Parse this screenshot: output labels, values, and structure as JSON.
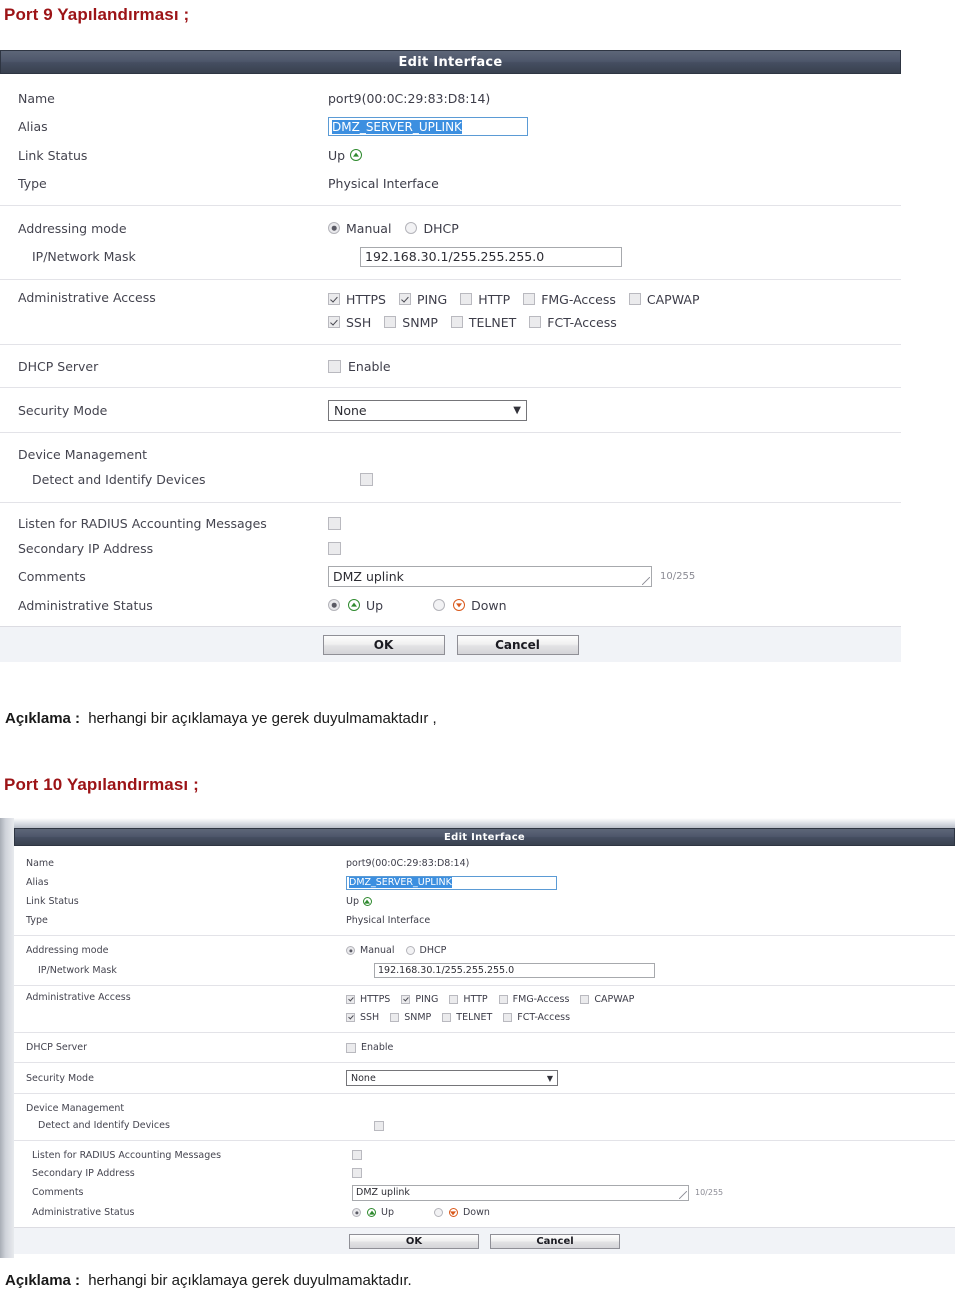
{
  "document": {
    "heading_1": "Port 9 Yapılandırması ;",
    "note_1_label": "Açıklama :",
    "note_1_text": "herhangi bir açıklamaya  ye gerek duyulmamaktadır ,",
    "heading_2": "Port 10 Yapılandırması ;",
    "note_2_label": "Açıklama :",
    "note_2_text": "herhangi bir açıklamaya  gerek duyulmamaktadır.",
    "heading_color": "#9c1316"
  },
  "dialog": {
    "title": "Edit Interface",
    "fields": {
      "name_label": "Name",
      "name_value": "port9(00:0C:29:83:D8:14)",
      "alias_label": "Alias",
      "alias_value": "DMZ_SERVER_UPLINK",
      "link_status_label": "Link Status",
      "link_status_value": "Up",
      "type_label": "Type",
      "type_value": "Physical Interface",
      "addressing_mode_label": "Addressing mode",
      "addressing_manual": "Manual",
      "addressing_dhcp": "DHCP",
      "addressing_selected": "Manual",
      "ip_mask_label": "IP/Network Mask",
      "ip_mask_value": "192.168.30.1/255.255.255.0",
      "admin_access_label": "Administrative Access",
      "dhcp_server_label": "DHCP Server",
      "dhcp_enable_label": "Enable",
      "dhcp_enable_checked": false,
      "security_mode_label": "Security Mode",
      "security_mode_value": "None",
      "device_management_label": "Device Management",
      "detect_devices_label": "Detect and Identify Devices",
      "detect_devices_checked": false,
      "radius_label": "Listen for RADIUS Accounting Messages",
      "radius_checked": false,
      "secondary_ip_label": "Secondary IP Address",
      "secondary_ip_checked": false,
      "comments_label": "Comments",
      "comments_value": "DMZ uplink",
      "comments_counter": "10/255",
      "admin_status_label": "Administrative Status",
      "admin_status_up": "Up",
      "admin_status_down": "Down",
      "admin_status_selected": "Up"
    },
    "admin_access_row1": [
      {
        "label": "HTTPS",
        "checked": true
      },
      {
        "label": "PING",
        "checked": true
      },
      {
        "label": "HTTP",
        "checked": false
      },
      {
        "label": "FMG-Access",
        "checked": false
      },
      {
        "label": "CAPWAP",
        "checked": false
      }
    ],
    "admin_access_row2": [
      {
        "label": "SSH",
        "checked": true
      },
      {
        "label": "SNMP",
        "checked": false
      },
      {
        "label": "TELNET",
        "checked": false
      },
      {
        "label": "FCT-Access",
        "checked": false
      }
    ],
    "buttons": {
      "ok": "OK",
      "cancel": "Cancel"
    },
    "icons": {
      "dropdown_caret": "▼"
    }
  }
}
